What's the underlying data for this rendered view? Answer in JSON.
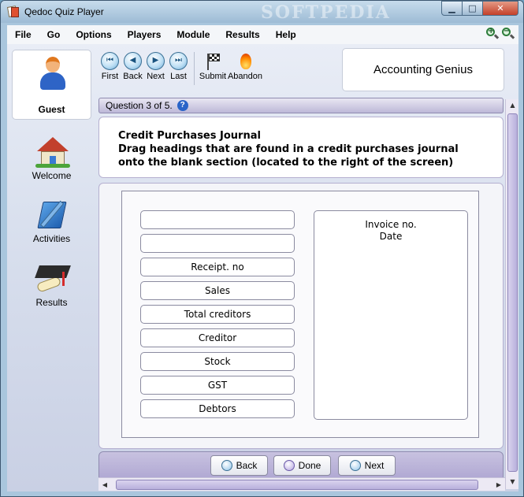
{
  "window": {
    "title": "Qedoc Quiz Player",
    "watermark": "SOFTPEDIA"
  },
  "menu": [
    "File",
    "Go",
    "Options",
    "Players",
    "Module",
    "Results",
    "Help"
  ],
  "sidebar": {
    "user": "Guest",
    "items": [
      {
        "label": "Welcome",
        "icon": "house-icon"
      },
      {
        "label": "Activities",
        "icon": "book-pen-icon"
      },
      {
        "label": "Results",
        "icon": "graduation-cap-icon"
      }
    ]
  },
  "toolbar": {
    "first": "First",
    "back": "Back",
    "next": "Next",
    "last": "Last",
    "submit": "Submit",
    "abandon": "Abandon"
  },
  "module_title": "Accounting Genius",
  "question": {
    "counter": "Question 3 of 5.",
    "title": "Credit Purchases Journal",
    "instruction": "Drag headings that are found in a credit purchases journal onto the blank section (located to the right of the screen)"
  },
  "headings": [
    "",
    "",
    "Receipt. no",
    "Sales",
    "Total creditors",
    "Creditor",
    "Stock",
    "GST",
    "Debtors"
  ],
  "dropzone": {
    "line1": "Invoice no.",
    "line2": "Date"
  },
  "nav": {
    "back": "Back",
    "done": "Done",
    "next": "Next"
  },
  "colors": {
    "accent": "#2a64c8",
    "panel_header": "#bdb8d8"
  }
}
